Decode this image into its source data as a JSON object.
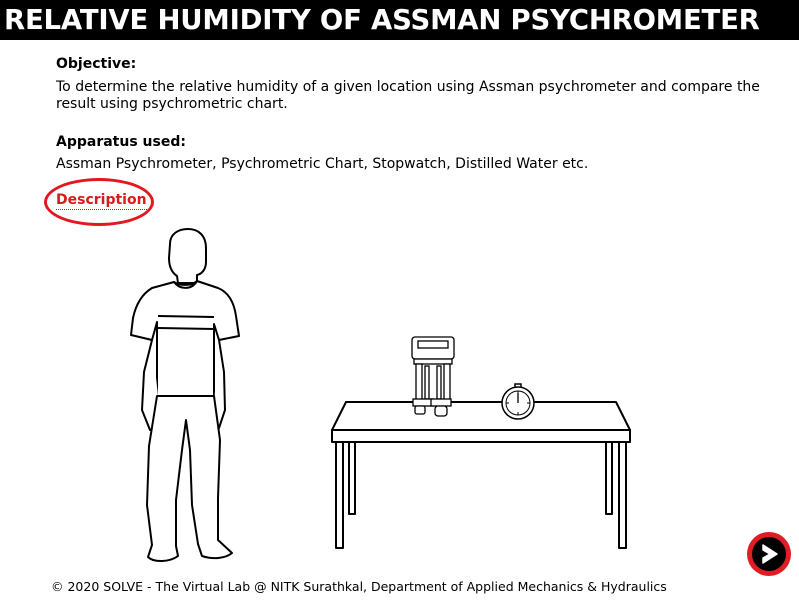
{
  "header": {
    "title": "RELATIVE HUMIDITY OF ASSMAN PSYCHROMETER"
  },
  "objective": {
    "heading": "Objective:",
    "text": "To determine the relative humidity of a given location using Assman psychrometer and compare the result using psychrometric chart."
  },
  "apparatus": {
    "heading": "Apparatus used:",
    "text": "Assman Psychrometer, Psychrometric Chart, Stopwatch, Distilled Water etc."
  },
  "description_link": {
    "label": "Description"
  },
  "navigation": {
    "next_icon": "next-arrow-icon"
  },
  "footer": {
    "text": "© 2020 SOLVE - The Virtual Lab @ NITK Surathkal, Department of Applied Mechanics & Hydraulics"
  },
  "colors": {
    "title_bar": "#000000",
    "title_text": "#ffffff",
    "accent_red": "#e3171e"
  }
}
